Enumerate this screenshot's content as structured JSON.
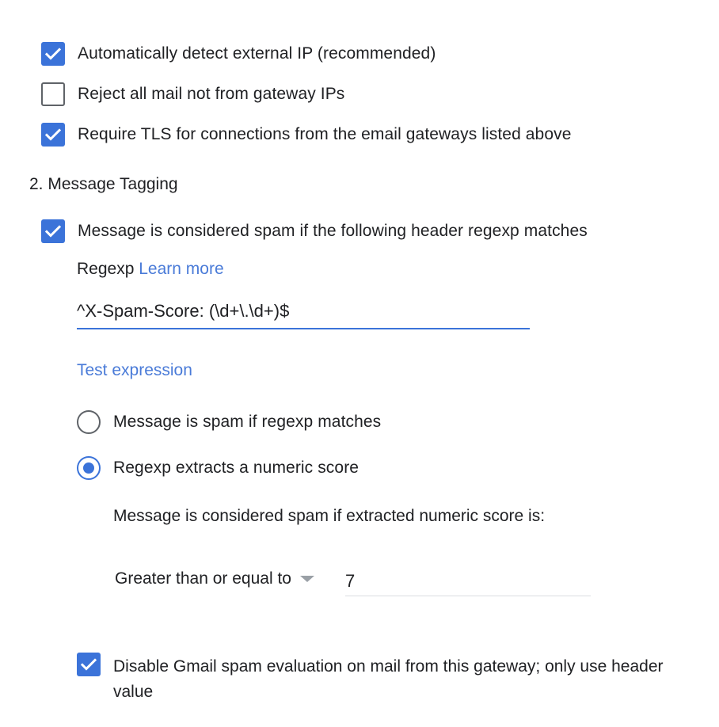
{
  "gateway_options": [
    {
      "label": "Automatically detect external IP (recommended)",
      "checked": true
    },
    {
      "label": "Reject all mail not from gateway IPs",
      "checked": false
    },
    {
      "label": "Require TLS for connections from the email gateways listed above",
      "checked": true
    }
  ],
  "section_heading": "2. Message Tagging",
  "spam_header": {
    "label": "Message is considered spam if the following header regexp matches",
    "checked": true
  },
  "regexp": {
    "label": "Regexp",
    "learn_more": "Learn more",
    "value": "^X-Spam-Score: (\\d+\\.\\d+)$",
    "test_link": "Test expression"
  },
  "mode_options": [
    {
      "label": "Message is spam if regexp matches",
      "selected": false
    },
    {
      "label": "Regexp extracts a numeric score",
      "selected": true
    }
  ],
  "score_rule": {
    "description": "Message is considered spam if extracted numeric score is:",
    "comparator": "Greater than or equal to",
    "threshold": "7"
  },
  "disable_gmail": {
    "label_line1": "Disable Gmail spam evaluation on mail from this gateway; only use header",
    "label_line2": "value",
    "checked": true
  },
  "colors": {
    "accent": "#3b73d9",
    "link": "#4a7bd8",
    "text": "#202124"
  }
}
